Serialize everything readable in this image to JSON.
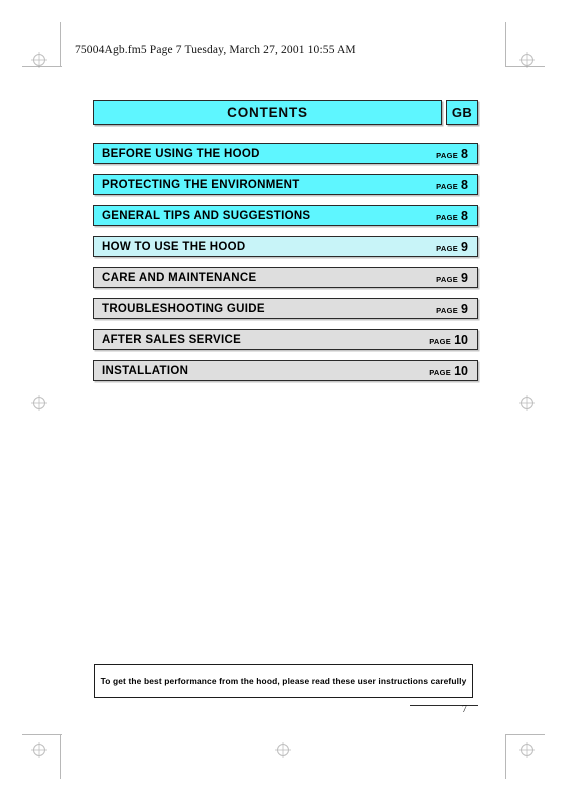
{
  "document": {
    "file_header": "75004Agb.fm5  Page 7  Tuesday, March 27, 2001  10:55 AM",
    "page_number": "7"
  },
  "contents": {
    "title": "CONTENTS",
    "language_code": "GB",
    "page_word": "PAGE",
    "entries": [
      {
        "label": "BEFORE USING THE HOOD",
        "page_word": "PAGE",
        "page": "8",
        "fill": "fill-cyan"
      },
      {
        "label": "PROTECTING THE ENVIRONMENT",
        "page_word": "PAGE",
        "page": "8",
        "fill": "fill-cyan"
      },
      {
        "label": "GENERAL TIPS AND SUGGESTIONS",
        "page_word": "PAGE",
        "page": "8",
        "fill": "fill-cyan"
      },
      {
        "label": "HOW TO USE THE HOOD",
        "page_word": "PAGE",
        "page": "9",
        "fill": "fill-pale"
      },
      {
        "label": "CARE AND MAINTENANCE",
        "page_word": "PAGE",
        "page": "9",
        "fill": "fill-grey"
      },
      {
        "label": "TROUBLESHOOTING GUIDE",
        "page_word": "PAGE",
        "page": "9",
        "fill": "fill-grey"
      },
      {
        "label": "AFTER SALES SERVICE",
        "page_word": "PAGE",
        "page": "10",
        "fill": "fill-grey"
      },
      {
        "label": "INSTALLATION",
        "page_word": "PAGE",
        "page": "10",
        "fill": "fill-grey"
      }
    ]
  },
  "notice": {
    "text": "To get the best performance from the hood, please read these user instructions carefully"
  },
  "colors": {
    "accent_cyan": "#5EF6FF",
    "pale_cyan": "#C8F4F8",
    "row_grey": "#DEDEDE",
    "ink": "#000000",
    "crop_mark": "#B8B8B8"
  }
}
